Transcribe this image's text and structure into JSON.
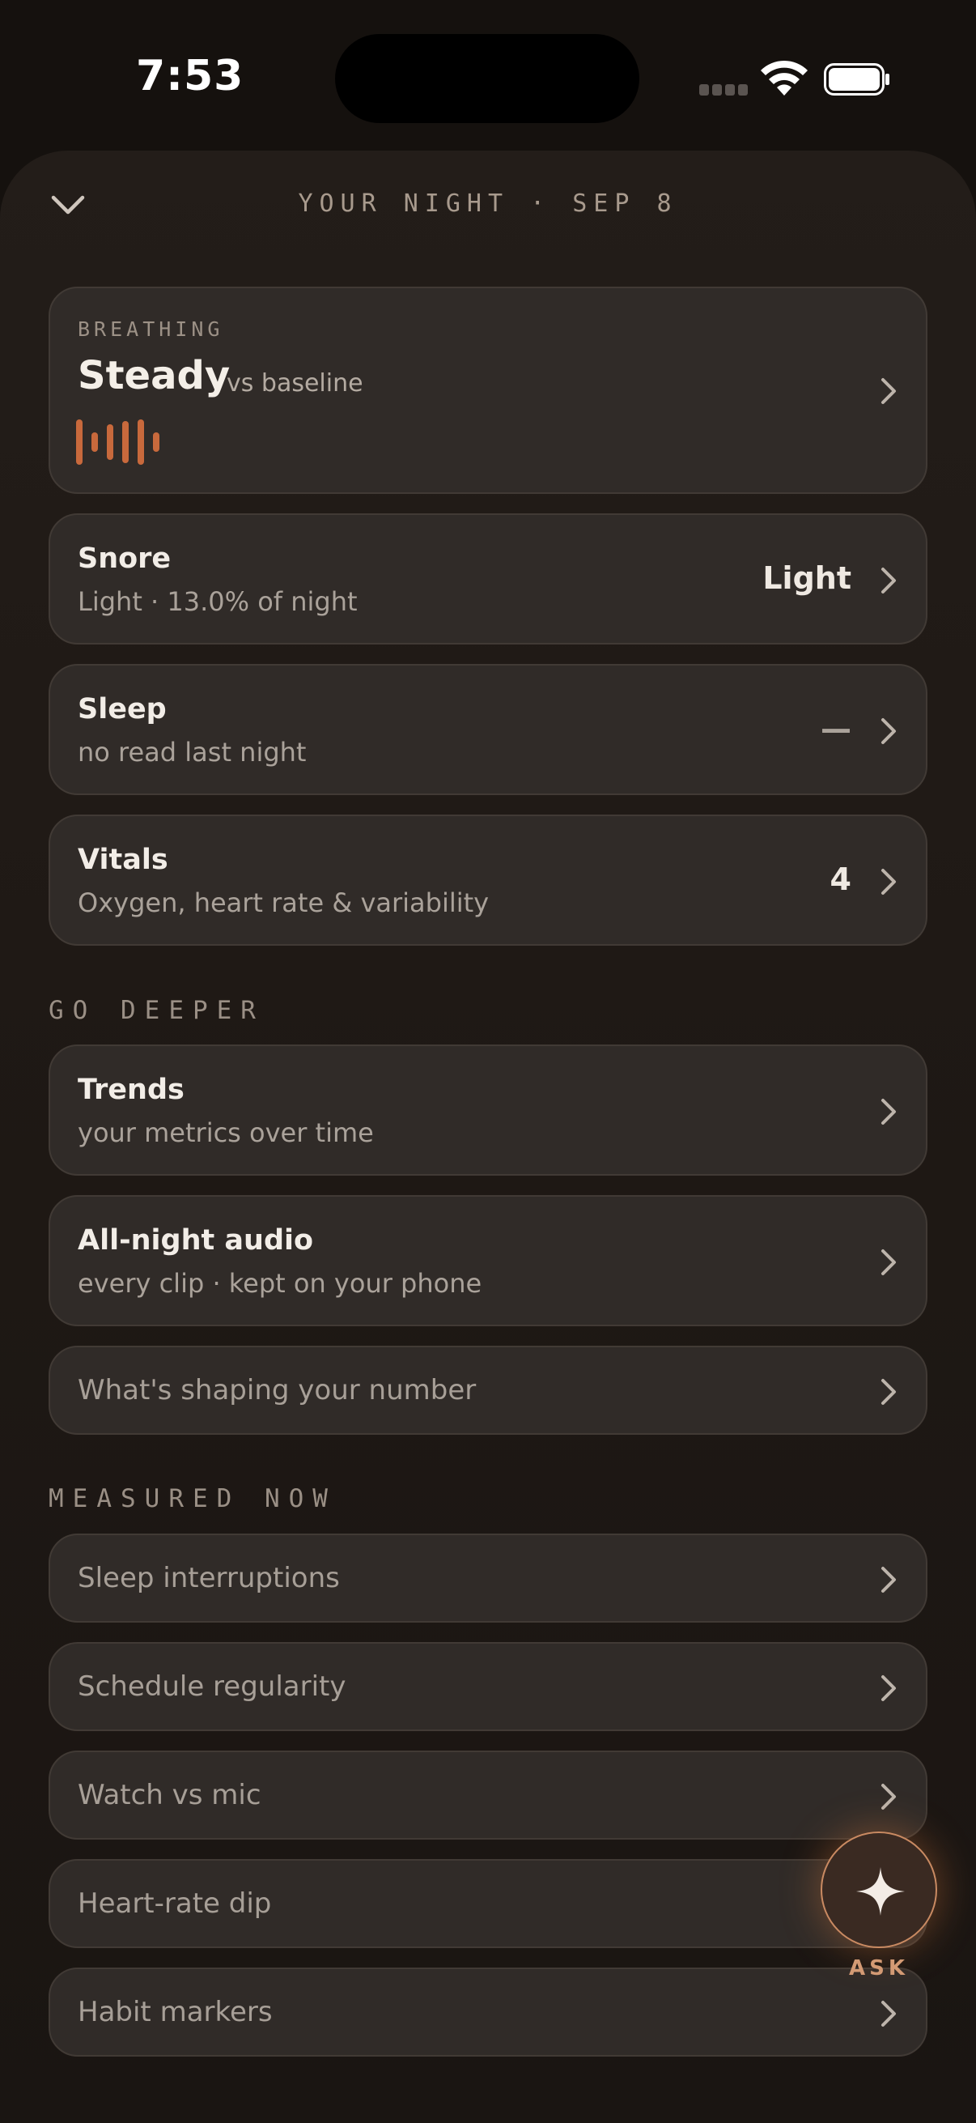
{
  "status": {
    "time": "7:53"
  },
  "header": {
    "title": "YOUR NIGHT · SEP 8"
  },
  "breathing": {
    "label": "BREATHING",
    "value": "Steady",
    "comparison": "vs baseline"
  },
  "rows": {
    "snore": {
      "title": "Snore",
      "subtitle": "Light · 13.0% of night",
      "value": "Light"
    },
    "sleep": {
      "title": "Sleep",
      "subtitle": "no read last night",
      "value": "—"
    },
    "vitals": {
      "title": "Vitals",
      "subtitle": "Oxygen, heart rate & variability",
      "value": "4"
    }
  },
  "go_deeper": {
    "label": "GO DEEPER",
    "trends": {
      "title": "Trends",
      "subtitle": "your metrics over time"
    },
    "audio": {
      "title": "All-night audio",
      "subtitle": "every clip · kept on your phone"
    },
    "shaping": {
      "title": "What's shaping your number"
    }
  },
  "measured_now": {
    "label": "MEASURED NOW",
    "items": [
      "Sleep interruptions",
      "Schedule regularity",
      "Watch vs mic",
      "Heart-rate dip",
      "Habit markers"
    ]
  },
  "ask": {
    "label": "ASK"
  },
  "colors": {
    "accent": "#c8693c",
    "card": "#302b28",
    "background": "#15110e"
  }
}
